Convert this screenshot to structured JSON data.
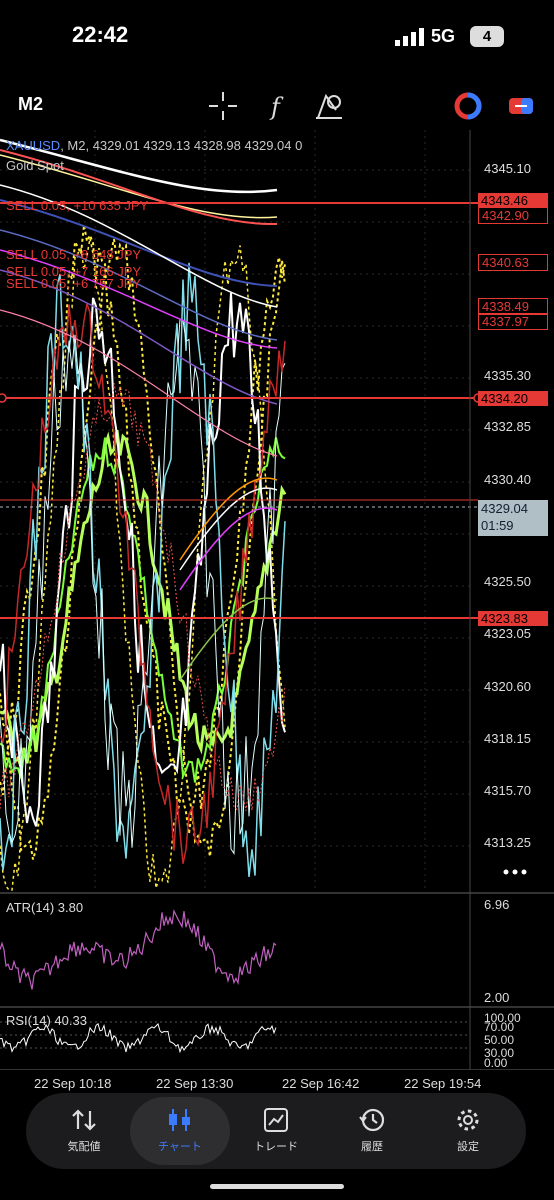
{
  "status_bar": {
    "time": "22:42",
    "network": "5G",
    "battery": "4"
  },
  "toolbar": {
    "timeframe": "M2"
  },
  "chart": {
    "symbol": "XAUUSD",
    "ohlc_info": ", M2, 4329.01 4329.13 4328.98 4329.04 0",
    "subtitle": "Gold Spot",
    "positions": [
      {
        "text": "SELL 0.05, +10 635 JPY"
      },
      {
        "text": "SELL 0.05, +8 648 JPY"
      },
      {
        "text": "SELL 0.05, +7 166 JPY"
      },
      {
        "text": "SELL 0.05, +6 757 JPY"
      }
    ],
    "price_axis": [
      "4345.10",
      "4335.30",
      "4332.85",
      "4330.40",
      "4325.50",
      "4323.05",
      "4320.60",
      "4318.15",
      "4315.70",
      "4313.25"
    ],
    "price_tags": {
      "filled": [
        "4343.46",
        "4334.20",
        "4323.83"
      ],
      "boxed": [
        "4342.90",
        "4340.63",
        "4338.49",
        "4337.97"
      ],
      "current_price": "4329.04",
      "countdown": "01:59"
    },
    "atr": {
      "label": "ATR(14) 3.80",
      "axis_max": "6.96",
      "axis_min": "2.00"
    },
    "rsi": {
      "label": "RSI(14) 40.33",
      "levels": [
        "100.00",
        "70.00",
        "50.00",
        "30.00",
        "0.00"
      ]
    },
    "time_axis": [
      "22 Sep 10:18",
      "22 Sep 13:30",
      "22 Sep 16:42",
      "22 Sep 19:54"
    ]
  },
  "nav": [
    {
      "label": "気配値",
      "icon": "quotes-arrows-icon"
    },
    {
      "label": "チャート",
      "icon": "candlestick-icon",
      "active": true
    },
    {
      "label": "トレード",
      "icon": "trade-chart-icon"
    },
    {
      "label": "履歴",
      "icon": "history-clock-icon"
    },
    {
      "label": "設定",
      "icon": "gear-icon"
    }
  ],
  "colors": {
    "accent": "#3b7bff",
    "sell_red": "#e53935",
    "bull": "#b6ff5a"
  }
}
